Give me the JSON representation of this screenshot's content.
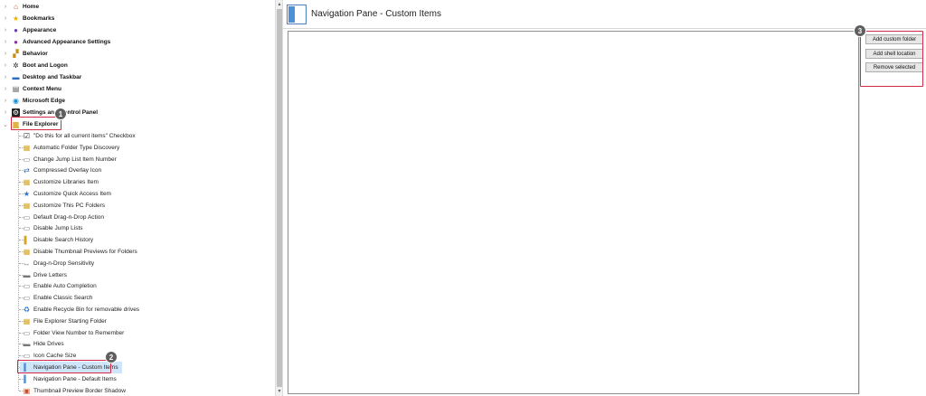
{
  "tree": {
    "top_items": [
      {
        "label": "Home",
        "icon": "home-icon",
        "expanded": false
      },
      {
        "label": "Bookmarks",
        "icon": "star-icon",
        "expanded": false
      },
      {
        "label": "Appearance",
        "icon": "palette-icon",
        "expanded": false
      },
      {
        "label": "Advanced Appearance Settings",
        "icon": "palette-advanced-icon",
        "expanded": false
      },
      {
        "label": "Behavior",
        "icon": "behavior-icon",
        "expanded": false
      },
      {
        "label": "Boot and Logon",
        "icon": "boot-icon",
        "expanded": false
      },
      {
        "label": "Desktop and Taskbar",
        "icon": "desktop-icon",
        "expanded": false
      },
      {
        "label": "Context Menu",
        "icon": "context-menu-icon",
        "expanded": false
      },
      {
        "label": "Microsoft Edge",
        "icon": "edge-icon",
        "expanded": false
      },
      {
        "label": "Settings and Control Panel",
        "icon": "gear-icon",
        "expanded": false
      },
      {
        "label": "File Explorer",
        "icon": "folder-icon",
        "expanded": true
      }
    ],
    "children": [
      "\"Do this for all current items\" Checkbox",
      "Automatic Folder Type Discovery",
      "Change Jump List Item Number",
      "Compressed Overlay Icon",
      "Customize Libraries Item",
      "Customize Quick Access Item",
      "Customize This PC Folders",
      "Default Drag-n-Drop Action",
      "Disable Jump Lists",
      "Disable Search History",
      "Disable Thumbnail Previews for Folders",
      "Drag-n-Drop Sensitivity",
      "Drive Letters",
      "Enable Auto Completion",
      "Enable Classic Search",
      "Enable Recycle Bin for removable drives",
      "File Explorer Starting Folder",
      "Folder View Number to Remember",
      "Hide Drives",
      "Icon Cache Size",
      "Navigation Pane - Custom Items",
      "Navigation Pane - Default Items",
      "Thumbnail Preview Border Shadow"
    ],
    "selected_child": "Navigation Pane - Custom Items"
  },
  "annotations": {
    "badge_1": "1",
    "badge_2": "2",
    "badge_3": "3"
  },
  "header": {
    "title": "Navigation Pane - Custom Items"
  },
  "buttons": {
    "add_custom_folder": "Add custom folder",
    "add_shell_location": "Add shell location",
    "remove_selected": "Remove selected"
  },
  "colors": {
    "highlight_red": "#d42a45",
    "badge_gray": "#5f5f5f",
    "accent_blue": "#4d8fd8"
  }
}
